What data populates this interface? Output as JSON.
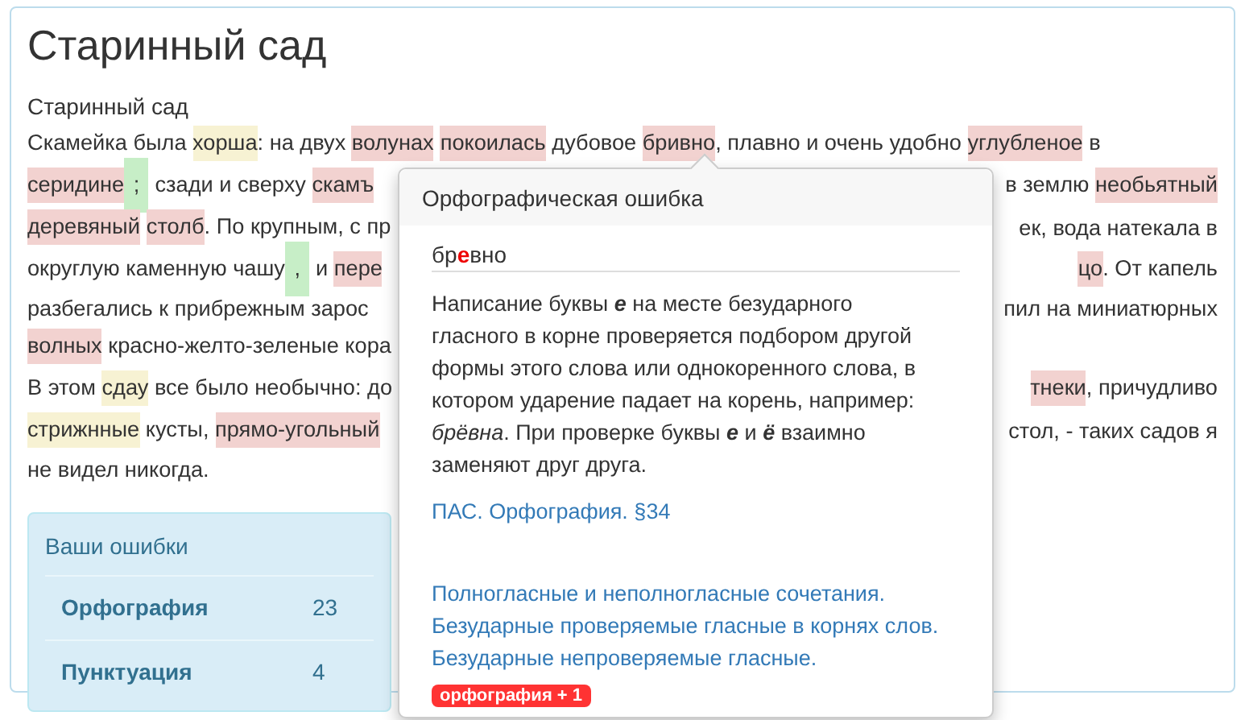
{
  "title": "Старинный сад",
  "subtitle": "Старинный сад",
  "lines": [
    {
      "left": [
        {
          "text": "Скамейка была ",
          "kind": "plain"
        },
        {
          "text": "хорша",
          "kind": "style"
        },
        {
          "text": ": на двух ",
          "kind": "plain"
        },
        {
          "text": "волунах",
          "kind": "spelling"
        },
        {
          "text": "покоилась",
          "kind": "spelling"
        },
        {
          "text": " дубовое ",
          "kind": "plain"
        },
        {
          "text": "бривно",
          "kind": "spelling"
        },
        {
          "text": ", плавно и очень удобно ",
          "kind": "plain"
        },
        {
          "text": "углубленое",
          "kind": "spelling"
        },
        {
          "text": " в",
          "kind": "plain"
        }
      ]
    },
    {
      "left": [
        {
          "text": "серидине",
          "kind": "spelling"
        },
        {
          "text": " ; ",
          "kind": "punctuation"
        },
        {
          "text": " сзади и сверху ",
          "kind": "plain"
        },
        {
          "text": "скамъ",
          "kind": "spelling"
        }
      ],
      "right": [
        {
          "text": "в землю ",
          "kind": "plain"
        },
        {
          "text": "необьятный",
          "kind": "spelling"
        }
      ]
    },
    {
      "left": [
        {
          "text": "деревяный",
          "kind": "spelling"
        },
        {
          "text": "столб",
          "kind": "spelling"
        },
        {
          "text": ". По крупным, с пр",
          "kind": "plain"
        }
      ],
      "right": [
        {
          "text": "ек, вода натекала в",
          "kind": "plain"
        }
      ]
    },
    {
      "left": [
        {
          "text": "округлую каменную чашу",
          "kind": "plain"
        },
        {
          "text": " , ",
          "kind": "punctuation"
        },
        {
          "text": " и ",
          "kind": "plain"
        },
        {
          "text": "пере",
          "kind": "spelling"
        }
      ],
      "right": [
        {
          "text": "цо",
          "kind": "spelling"
        },
        {
          "text": ". От капель",
          "kind": "plain"
        }
      ]
    },
    {
      "left": [
        {
          "text": "разбегались к прибрежным зарос",
          "kind": "plain"
        }
      ],
      "right": [
        {
          "text": "пил на миниатюрных",
          "kind": "plain"
        }
      ]
    },
    {
      "left": [
        {
          "text": "волных",
          "kind": "spelling"
        },
        {
          "text": " красно-желто-зеленые кора",
          "kind": "plain"
        }
      ]
    },
    {
      "left": [
        {
          "text": "В этом ",
          "kind": "plain"
        },
        {
          "text": "сдау",
          "kind": "style"
        },
        {
          "text": " все было необычно: до",
          "kind": "plain"
        }
      ],
      "right": [
        {
          "text": "тнеки",
          "kind": "spelling"
        },
        {
          "text": ", причудливо",
          "kind": "plain"
        }
      ]
    },
    {
      "left": [
        {
          "text": "стрижнные",
          "kind": "style"
        },
        {
          "text": " кусты, ",
          "kind": "plain"
        },
        {
          "text": "прямо-угольный",
          "kind": "spelling"
        }
      ],
      "right": [
        {
          "text": "стол, - таких садов я",
          "kind": "plain"
        }
      ]
    },
    {
      "left": [
        {
          "text": "не видел никогда.",
          "kind": "plain"
        }
      ]
    }
  ],
  "summary": {
    "title": "Ваши ошибки",
    "rows": [
      {
        "label": "Орфография",
        "count": "23"
      },
      {
        "label": "Пунктуация",
        "count": "4"
      }
    ]
  },
  "popover": {
    "title": "Орфографическая ошибка",
    "word": "бр**е**вно",
    "explanation": "Написание буквы **е** на месте безударного гласного в корне проверяется подбором другой формы этого слова или однокоренного слова, в котором ударение падает на корень, например: *брёвна*. При проверке буквы **е** и **ё** взаимно заменяют друг друга.",
    "rule_link": "ПАС. Орфография. §34",
    "related_links": [
      "Полногласные и неполногласные сочетания.",
      "Безударные проверяемые гласные в корнях слов.",
      "Безударные непроверяемые гласные."
    ],
    "badge": "орфография + 1"
  }
}
